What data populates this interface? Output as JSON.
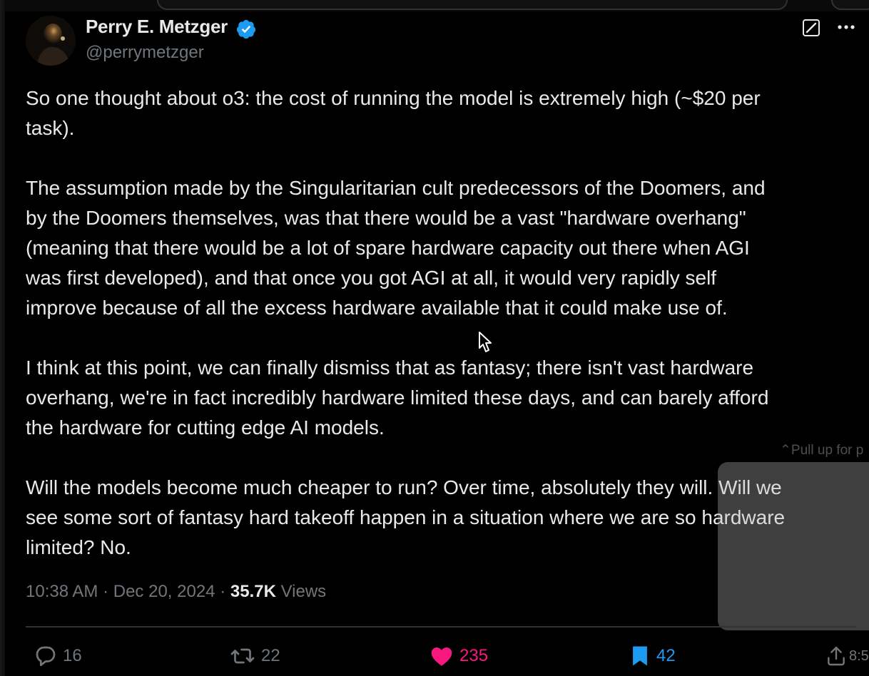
{
  "tweet": {
    "author": {
      "display_name": "Perry E. Metzger",
      "handle": "@perrymetzger",
      "verified": true
    },
    "paragraphs": [
      [
        "So one thought about o3: the cost of running the model is extremely high (~$20 per",
        "task)."
      ],
      [
        "The assumption made by the Singularitarian cult predecessors of the Doomers, and",
        "by the Doomers themselves, was that there would be a vast \"hardware overhang\"",
        "(meaning that there would be a lot of spare hardware capacity out there when AGI",
        "was first developed), and that once you got AGI at all, it would very rapidly self",
        "improve because of all the excess hardware available that it could make use of."
      ],
      [
        "I think at this point, we can finally dismiss that as fantasy; there isn't vast hardware",
        "overhang, we're in fact incredibly hardware limited these days, and can barely afford",
        "the hardware for cutting edge AI models."
      ],
      [
        "Will the models become much cheaper to run? Over time, absolutely they will. Will we",
        "see some sort of fantasy hard takeoff happen in a situation where we are so hardware",
        "limited? No."
      ]
    ],
    "time": "10:38 AM",
    "date": "Dec 20, 2024",
    "separator": "·",
    "views_count": "35.7K",
    "views_label": "Views",
    "stats": {
      "replies": "16",
      "reposts": "22",
      "likes": "235",
      "bookmarks": "42",
      "share_partial": "8:5"
    }
  },
  "overlay": {
    "pull_hint": "Pull up for p"
  },
  "icons": {
    "verified": "verified-badge-icon",
    "grok": "grok-icon",
    "more": "more-icon",
    "reply": "reply-icon",
    "repost": "repost-icon",
    "like": "heart-icon",
    "bookmark": "bookmark-icon",
    "share": "share-icon"
  },
  "colors": {
    "background": "#000000",
    "text": "#e7e9ea",
    "muted": "#71767b",
    "verified": "#1d9bf0",
    "like": "#f91880",
    "bookmark": "#1d9bf0",
    "divider": "#2f3336"
  }
}
